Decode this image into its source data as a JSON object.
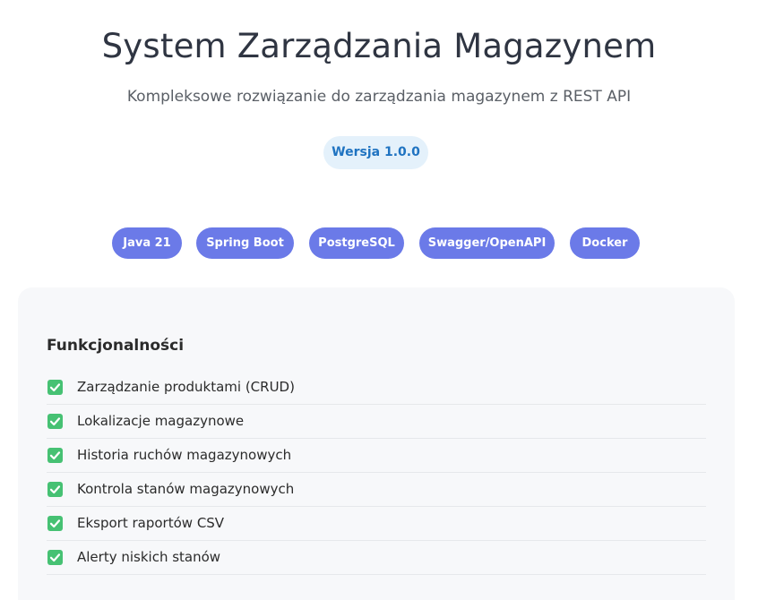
{
  "header": {
    "title": "System Zarządzania Magazynem",
    "subtitle": "Kompleksowe rozwiązanie do zarządzania magazynem z REST API",
    "version_label": "Wersja 1.0.0"
  },
  "tech_stack": [
    {
      "label": "Java 21"
    },
    {
      "label": "Spring Boot"
    },
    {
      "label": "PostgreSQL"
    },
    {
      "label": "Swagger/OpenAPI"
    },
    {
      "label": "Docker"
    }
  ],
  "features": {
    "title": "Funkcjonalności",
    "items": [
      {
        "label": "Zarządzanie produktami (CRUD)",
        "icon": "check-icon"
      },
      {
        "label": "Lokalizacje magazynowe",
        "icon": "check-icon"
      },
      {
        "label": "Historia ruchów magazynowych",
        "icon": "check-icon"
      },
      {
        "label": "Kontrola stanów magazynowych",
        "icon": "check-icon"
      },
      {
        "label": "Eksport raportów CSV",
        "icon": "check-icon"
      },
      {
        "label": "Alerty niskich stanów",
        "icon": "check-icon"
      }
    ]
  },
  "colors": {
    "accent": "#6b7ae8",
    "version_badge_bg": "#e4f1fb",
    "version_badge_text": "#1f73c1",
    "check": "#46c173",
    "card_bg": "#f7f8fa"
  }
}
